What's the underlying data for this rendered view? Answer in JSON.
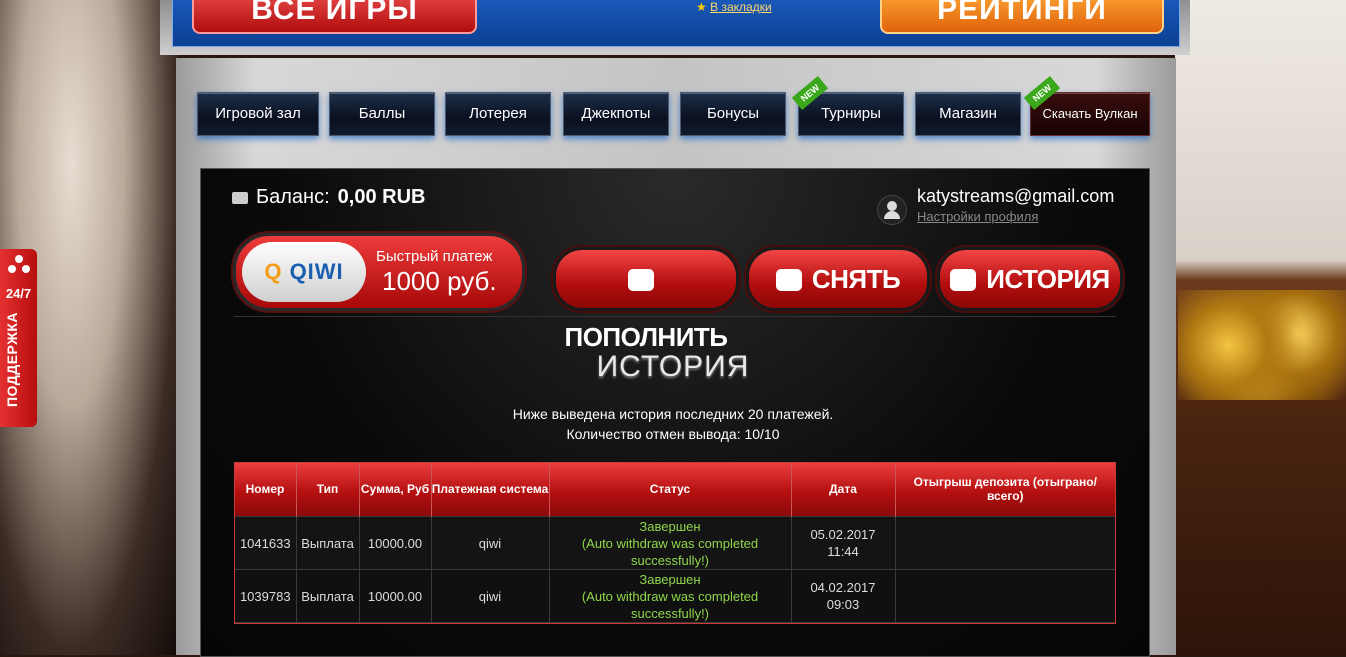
{
  "banner": {
    "all_games": "ВСЕ ИГРЫ",
    "ratings": "РЕЙТИНГИ",
    "bookmarks": "В закладки"
  },
  "nav": [
    {
      "label": "Игровой зал",
      "new": false
    },
    {
      "label": "Баллы",
      "new": false
    },
    {
      "label": "Лотерея",
      "new": false
    },
    {
      "label": "Джекпоты",
      "new": false
    },
    {
      "label": "Бонусы",
      "new": false
    },
    {
      "label": "Турниры",
      "new": true
    },
    {
      "label": "Магазин",
      "new": false
    },
    {
      "label": "Скачать Вулкан",
      "new": true
    }
  ],
  "new_badge": "NEW",
  "account": {
    "balance_label": "Баланс:",
    "balance_value": "0,00 RUB",
    "email": "katystreams@gmail.com",
    "settings_link": "Настройки профиля"
  },
  "qiwi": {
    "logo": "QIWI",
    "line1": "Быстрый платеж",
    "line2": "1000 руб."
  },
  "actions": {
    "deposit": "ПОПОЛНИТЬ",
    "withdraw": "СНЯТЬ",
    "history": "ИСТОРИЯ"
  },
  "history": {
    "title": "ИСТОРИЯ",
    "subtitle1": "Ниже выведена история последних 20 платежей.",
    "subtitle2": "Количество отмен вывода: 10/10",
    "columns": [
      "Номер",
      "Тип",
      "Сумма, Руб",
      "Платежная система",
      "Статус",
      "Дата",
      "Отыгрыш депозита (отыграно/всего)"
    ],
    "rows": [
      {
        "number": "1041633",
        "type": "Выплата",
        "amount": "10000.00",
        "system": "qiwi",
        "status": "Завершен",
        "status_note": "(Auto withdraw was completed successfully!)",
        "date": "05.02.2017",
        "time": "11:44",
        "wager": ""
      },
      {
        "number": "1039783",
        "type": "Выплата",
        "amount": "10000.00",
        "system": "qiwi",
        "status": "Завершен",
        "status_note": "(Auto withdraw was completed successfully!)",
        "date": "04.02.2017",
        "time": "09:03",
        "wager": ""
      }
    ]
  },
  "support": {
    "hours": "24/7",
    "label": "ПОДДЕРЖКА"
  },
  "colors": {
    "accent_red": "#d11a1a",
    "status_green": "#8fd64b",
    "qiwi_orange": "#f29c18",
    "qiwi_blue": "#1b5fb0"
  }
}
